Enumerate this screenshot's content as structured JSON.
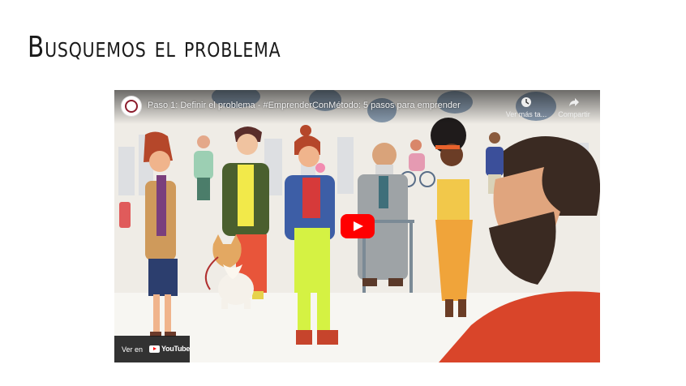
{
  "slide": {
    "title": "Busquemos el problema"
  },
  "video": {
    "title": "Paso 1: Definir el problema - #EmprenderConMétodo: 5 pasos para emprender",
    "watch_later_label": "Ver más ta...",
    "share_label": "Compartir",
    "watch_on_label": "Ver en",
    "brand_label": "YouTube",
    "icons": [
      "clock-icon",
      "share-icon",
      "play-icon",
      "youtube-logo-icon"
    ],
    "accent_color": "#ff0000"
  }
}
